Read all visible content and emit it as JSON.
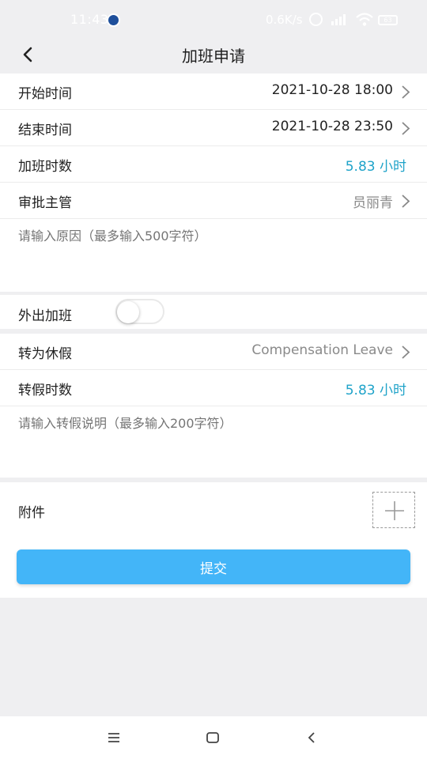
{
  "status_bar": {
    "time": "11:43",
    "network_speed": "0.6K/s",
    "battery": "63",
    "icons": [
      "app-notification-icon",
      "alarm-icon",
      "signal-icon",
      "wifi-icon",
      "battery-icon"
    ]
  },
  "header": {
    "title": "加班申请",
    "back_icon": "chevron-left-icon"
  },
  "form": {
    "start_time": {
      "label": "开始时间",
      "value": "2021-10-28 18:00"
    },
    "end_time": {
      "label": "结束时间",
      "value": "2021-10-28 23:50"
    },
    "overtime_hours": {
      "label": "加班时数",
      "value": "5.83 小时"
    },
    "approver": {
      "label": "审批主管",
      "value": "员丽青"
    },
    "reason_placeholder": "请输入原因（最多输入500字符）",
    "outside_overtime": {
      "label": "外出加班",
      "enabled": false
    },
    "convert_leave": {
      "label": "转为休假",
      "value": "Compensation Leave"
    },
    "leave_hours": {
      "label": "转假时数",
      "value": "5.83 小时"
    },
    "leave_note_placeholder": "请输入转假说明（最多输入200字符）",
    "attachment": {
      "label": "附件",
      "add_icon": "plus-icon"
    }
  },
  "submit_label": "提交",
  "colors": {
    "accent_teal": "#1fa3c9",
    "button_blue": "#43b5f8",
    "background": "#efeff1"
  },
  "nav_bar": {
    "icons": [
      "menu-icon",
      "home-icon",
      "back-icon"
    ]
  }
}
